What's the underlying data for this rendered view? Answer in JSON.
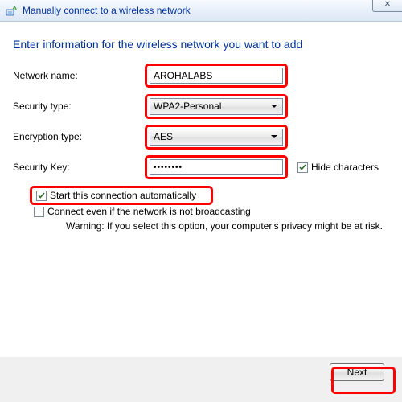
{
  "window": {
    "title": "Manually connect to a wireless network",
    "close_glyph": "✕"
  },
  "heading": "Enter information for the wireless network you want to add",
  "fields": {
    "network_name": {
      "label": "Network name:",
      "value": "AROHALABS"
    },
    "security_type": {
      "label": "Security type:",
      "value": "WPA2-Personal"
    },
    "encryption_type": {
      "label": "Encryption type:",
      "value": "AES"
    },
    "security_key": {
      "label": "Security Key:",
      "value": "••••••••"
    },
    "hide_characters": {
      "label": "Hide characters",
      "checked": true
    }
  },
  "options": {
    "autostart": {
      "label": "Start this connection automatically",
      "checked": true
    },
    "connect_hidden": {
      "label": "Connect even if the network is not broadcasting",
      "checked": false
    },
    "warning": "Warning: If you select this option, your computer's privacy might be at risk."
  },
  "footer": {
    "next": "Next"
  }
}
